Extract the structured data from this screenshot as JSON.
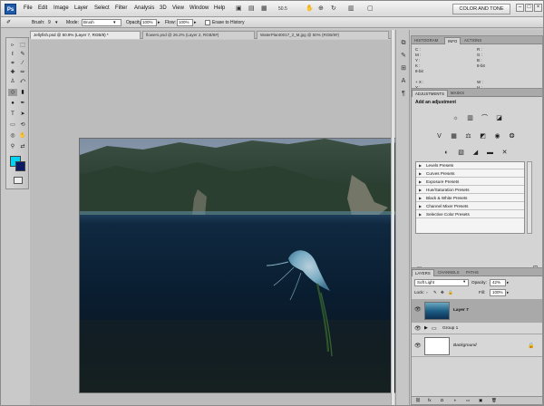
{
  "app": {
    "logo": "Ps",
    "workspace": "COLOR AND TONE",
    "zoom": "50.5"
  },
  "menu": [
    "File",
    "Edit",
    "Image",
    "Layer",
    "Select",
    "Filter",
    "Analysis",
    "3D",
    "View",
    "Window",
    "Help"
  ],
  "options": {
    "brush_label": "Brush:",
    "brush_size": "9",
    "mode_label": "Mode:",
    "mode_value": "Brush",
    "opacity_label": "Opacity:",
    "opacity_value": "100%",
    "flow_label": "Flow:",
    "flow_value": "100%",
    "history_label": "Erase to History"
  },
  "documents": [
    {
      "title": "Jellyfish.psd @ 50.9% (Layer 7, RGB/8) *",
      "active": true
    },
    {
      "title": "flowers.psd @ 26.2% (Layer 2, RGB/8#)",
      "active": false
    },
    {
      "title": "WaterPlant0017_2_M.jpg @ 50% (RGB/8#)",
      "active": false
    }
  ],
  "colors": {
    "foreground": "#00d2f3",
    "background": "#0a1a66"
  },
  "panels": {
    "info": {
      "tabs": [
        "Histogram",
        "Info",
        "Actions"
      ],
      "rows": [
        {
          "left": "C :",
          "right": "R :"
        },
        {
          "left": "M :",
          "right": "G :"
        },
        {
          "left": "Y :",
          "right": "B :"
        },
        {
          "left": "K :",
          "right": "8-bit"
        },
        {
          "left": "8-bit",
          "right": ""
        },
        {
          "left": "+ X :",
          "right": "W :"
        },
        {
          "left": "Y :",
          "right": "H :"
        }
      ]
    },
    "adjustments": {
      "tabs": [
        "Adjustments",
        "Masks"
      ],
      "title": "Add an adjustment",
      "presets": [
        "Levels Presets",
        "Curves Presets",
        "Exposure Presets",
        "Hue/Saturation Presets",
        "Black & White Presets",
        "Channel Mixer Presets",
        "Selective Color Presets"
      ]
    },
    "layers": {
      "tabs": [
        "Layers",
        "Channels",
        "Paths"
      ],
      "blend_mode": "Soft Light",
      "opacity_label": "Opacity:",
      "opacity_value": "42%",
      "lock_label": "Lock:",
      "fill_label": "Fill:",
      "fill_value": "100%",
      "items": [
        {
          "name": "Layer 7",
          "type": "layer",
          "selected": true
        },
        {
          "name": "Group 1",
          "type": "group",
          "selected": false
        },
        {
          "name": "Background",
          "type": "background",
          "selected": false
        }
      ]
    }
  }
}
